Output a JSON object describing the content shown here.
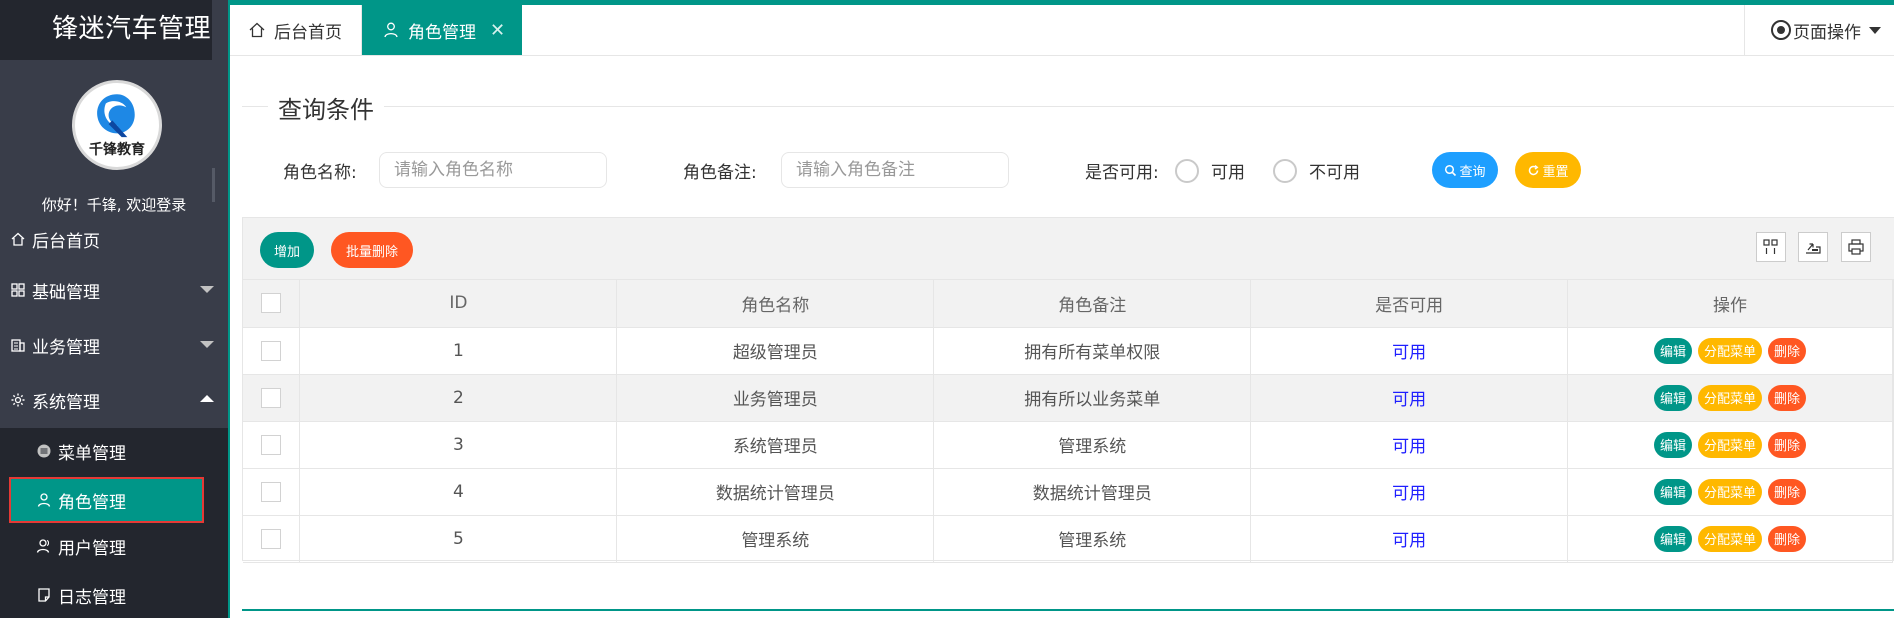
{
  "brand": {
    "title": "锋迷汽车管理",
    "logo_text": "千锋教育"
  },
  "user": {
    "welcome": "你好！千锋, 欢迎登录"
  },
  "sidebar": {
    "home": "后台首页",
    "basic": "基础管理",
    "business": "业务管理",
    "system": "系统管理",
    "sub": {
      "menu": "菜单管理",
      "role": "角色管理",
      "user": "用户管理",
      "log": "日志管理"
    }
  },
  "tabs": {
    "home": "后台首页",
    "active": "角色管理",
    "close": "✕",
    "page_op": "页面操作"
  },
  "query": {
    "title": "查询条件",
    "role_name_label": "角色名称:",
    "role_name_placeholder": "请输入角色名称",
    "role_remark_label": "角色备注:",
    "role_remark_placeholder": "请输入角色备注",
    "available_label": "是否可用:",
    "opt_yes": "可用",
    "opt_no": "不可用",
    "search_btn": "查询",
    "reset_btn": "重置"
  },
  "toolbar": {
    "add": "增加",
    "batch_delete": "批量删除"
  },
  "table": {
    "headers": [
      "ID",
      "角色名称",
      "角色备注",
      "是否可用",
      "操作"
    ],
    "actions": {
      "edit": "编辑",
      "assign": "分配菜单",
      "delete": "删除"
    },
    "rows": [
      {
        "id": "1",
        "name": "超级管理员",
        "remark": "拥有所有菜单权限",
        "available": "可用"
      },
      {
        "id": "2",
        "name": "业务管理员",
        "remark": "拥有所以业务菜单",
        "available": "可用"
      },
      {
        "id": "3",
        "name": "系统管理员",
        "remark": "管理系统",
        "available": "可用"
      },
      {
        "id": "4",
        "name": "数据统计管理员",
        "remark": "数据统计管理员",
        "available": "可用"
      },
      {
        "id": "5",
        "name": "管理系统",
        "remark": "管理系统",
        "available": "可用"
      }
    ]
  },
  "colors": {
    "primary": "#009688",
    "sidebar": "#393d49",
    "sidebar_dark": "#23262e",
    "blue": "#1e9fff",
    "yellow": "#ffb800",
    "orange": "#ff5722",
    "link": "#1e1eff"
  }
}
